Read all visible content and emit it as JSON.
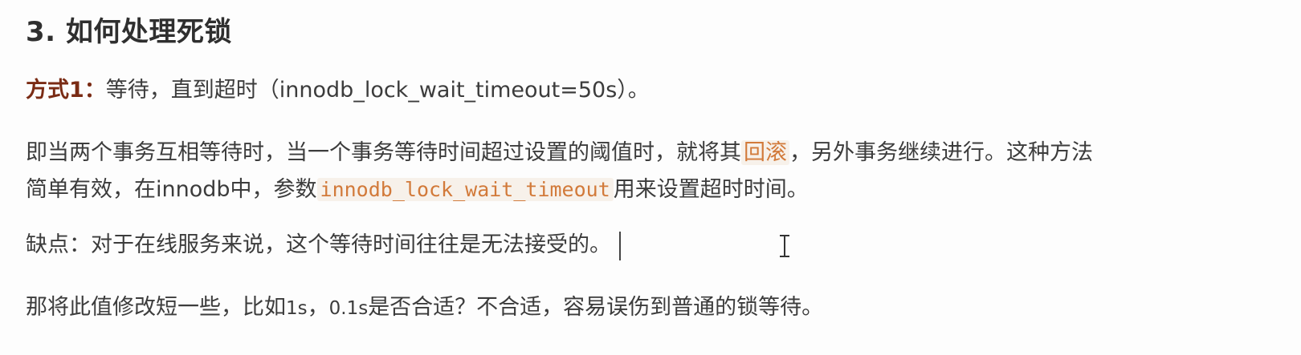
{
  "heading": "3. 如何处理死锁",
  "method1": {
    "label": "方式1：",
    "text": "等待，直到超时（innodb_lock_wait_timeout=50s）。"
  },
  "para2": {
    "line1_pre": "即当两个事务互相等待时，当一个事务等待时间超过设置的阈值时，就将其",
    "line1_highlight": "回滚",
    "line1_post": "，另外事务继续进行。这种方法",
    "line2_pre": "简单有效，在innodb中，参数",
    "line2_code": "innodb_lock_wait_timeout",
    "line2_post": "用来设置超时时间。"
  },
  "para3": {
    "text": "缺点：对于在线服务来说，这个等待时间往往是无法接受的。"
  },
  "para4": {
    "pre": "那将此值修改短一些，比如",
    "v1": "1s",
    "sep": "，",
    "v2": "0.1s",
    "post": "是否合适？不合适，容易误伤到普通的锁等待。"
  },
  "icons": {
    "text_caret": "text-caret-icon",
    "mouse_cursor": "ibeam-cursor-icon"
  },
  "colors": {
    "method_label": "#7a2b14",
    "highlight": "#d27a3a",
    "highlight_bg": "#f7f1ea"
  }
}
